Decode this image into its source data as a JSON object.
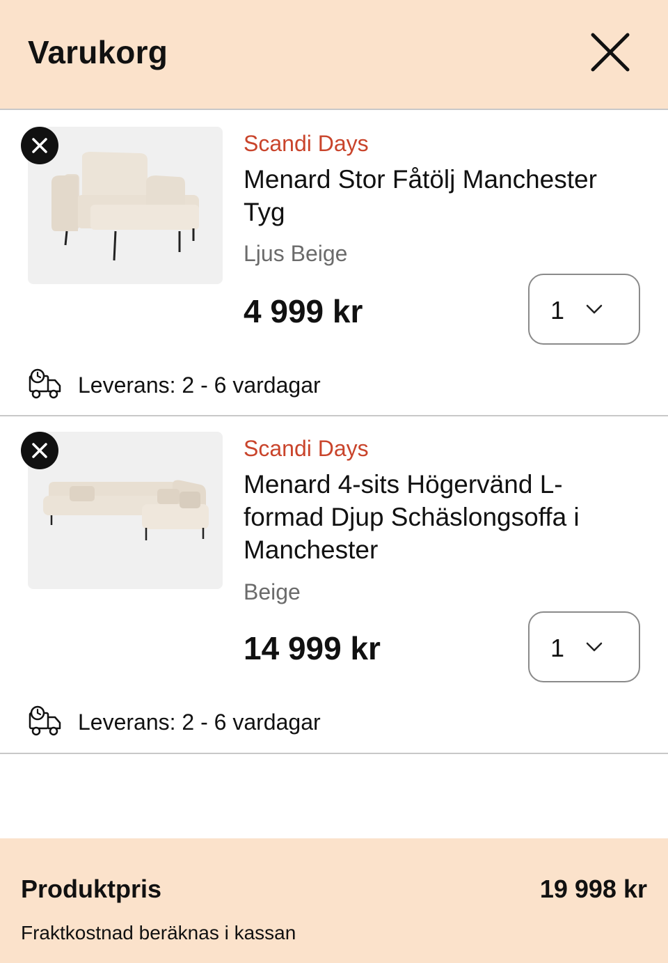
{
  "header": {
    "title": "Varukorg"
  },
  "items": [
    {
      "brand": "Scandi Days",
      "title": "Menard Stor Fåtölj Manchester Tyg",
      "variant": "Ljus Beige",
      "price": "4 999 kr",
      "quantity": "1",
      "delivery": "Leverans: 2 - 6 vardagar"
    },
    {
      "brand": "Scandi Days",
      "title": "Menard 4-sits Högervänd L-formad Djup Schäslongsoffa i Manchester",
      "variant": "Beige",
      "price": "14 999 kr",
      "quantity": "1",
      "delivery": "Leverans: 2 - 6 vardagar"
    }
  ],
  "footer": {
    "label": "Produktpris",
    "total": "19 998 kr",
    "note": "Fraktkostnad beräknas i kassan"
  },
  "colors": {
    "header_bg": "#fbe2cb",
    "brand_accent": "#c9442b",
    "footer_bg": "#fbe2cb"
  },
  "icons": [
    "close-icon",
    "remove-item-icon",
    "chevron-down-icon",
    "delivery-truck-icon"
  ]
}
